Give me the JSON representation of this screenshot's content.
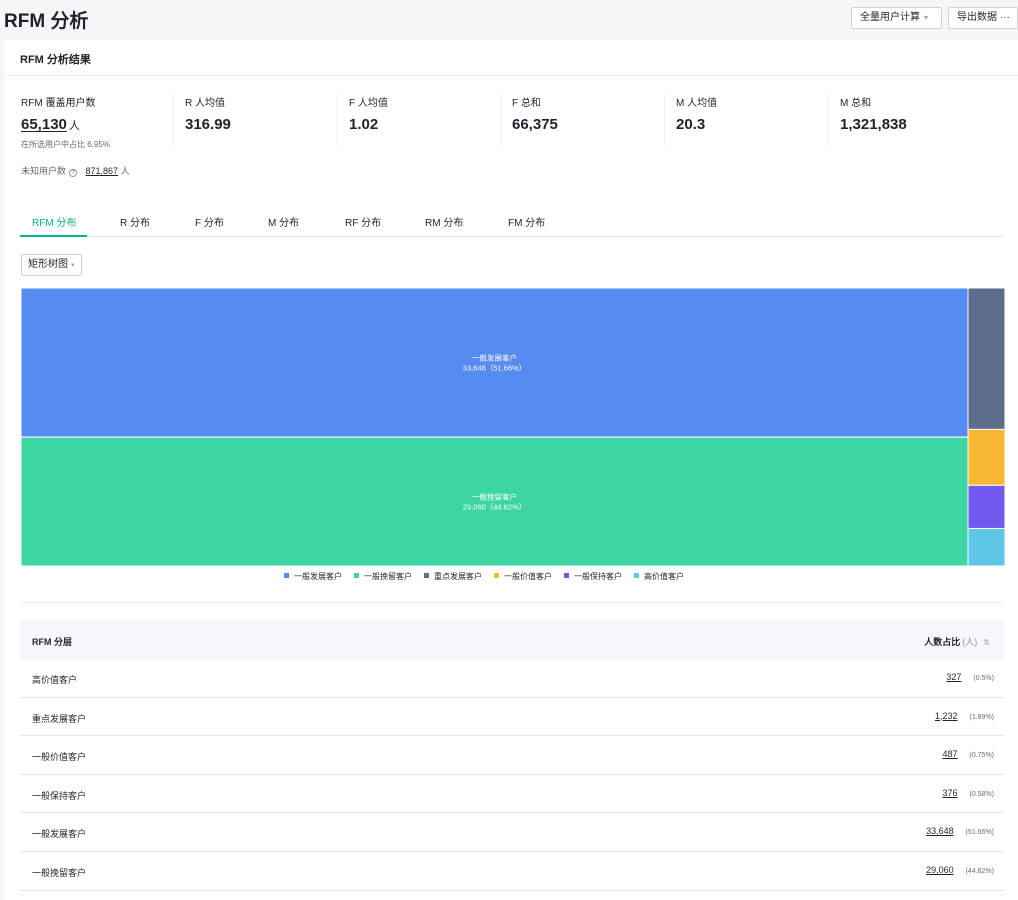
{
  "page": {
    "title": "RFM 分析"
  },
  "toolbar": {
    "calc_label": "全量用户计算",
    "calc_caret": "▾",
    "export_label": "导出数据",
    "more_label": "···"
  },
  "card": {
    "title": "RFM 分析结果"
  },
  "metrics": [
    {
      "label": "RFM 覆盖用户数",
      "value": "65,130",
      "unit": "人",
      "sub": "在所选用户中占比 6.95%"
    },
    {
      "label": "R 人均值",
      "value": "316.99"
    },
    {
      "label": "F 人均值",
      "value": "1.02"
    },
    {
      "label": "F 总和",
      "value": "66,375"
    },
    {
      "label": "M 人均值",
      "value": "20.3"
    },
    {
      "label": "M 总和",
      "value": "1,321,838"
    }
  ],
  "unknown_users": {
    "label": "未知用户数",
    "help": "?",
    "value": "871,867",
    "unit": "人"
  },
  "tabs": [
    "RFM 分布",
    "R 分布",
    "F 分布",
    "M 分布",
    "RF 分布",
    "RM 分布",
    "FM 分布"
  ],
  "view_select": {
    "label": "矩形树图",
    "caret": "▾"
  },
  "chart_data": {
    "type": "treemap",
    "items": [
      {
        "name": "一般发展客户",
        "value": 33648,
        "percent": "51.66%",
        "color": "#568bf2"
      },
      {
        "name": "一般挽留客户",
        "value": 29060,
        "percent": "44.62%",
        "color": "#3dd5a3"
      },
      {
        "name": "重点发展客户",
        "value": 1232,
        "percent": "1.89%",
        "color": "#5c6e8c"
      },
      {
        "name": "一般价值客户",
        "value": 487,
        "percent": "0.75%",
        "color": "#f7b733"
      },
      {
        "name": "一般保持客户",
        "value": 376,
        "percent": "0.58%",
        "color": "#7059ef"
      },
      {
        "name": "高价值客户",
        "value": 327,
        "percent": "0.5%",
        "color": "#5ec7e8"
      }
    ]
  },
  "table": {
    "headers": {
      "name": "RFM 分层",
      "count": "人数占比",
      "count_unit": "(人)",
      "sort": "⇅"
    },
    "rows": [
      {
        "name": "高价值客户",
        "count": "327",
        "pct": "(0.5%)"
      },
      {
        "name": "重点发展客户",
        "count": "1,232",
        "pct": "(1.89%)"
      },
      {
        "name": "一般价值客户",
        "count": "487",
        "pct": "(0.75%)"
      },
      {
        "name": "一般保持客户",
        "count": "376",
        "pct": "(0.58%)"
      },
      {
        "name": "一般发展客户",
        "count": "33,648",
        "pct": "(51.66%)"
      },
      {
        "name": "一般挽留客户",
        "count": "29,060",
        "pct": "(44.62%)"
      }
    ]
  }
}
